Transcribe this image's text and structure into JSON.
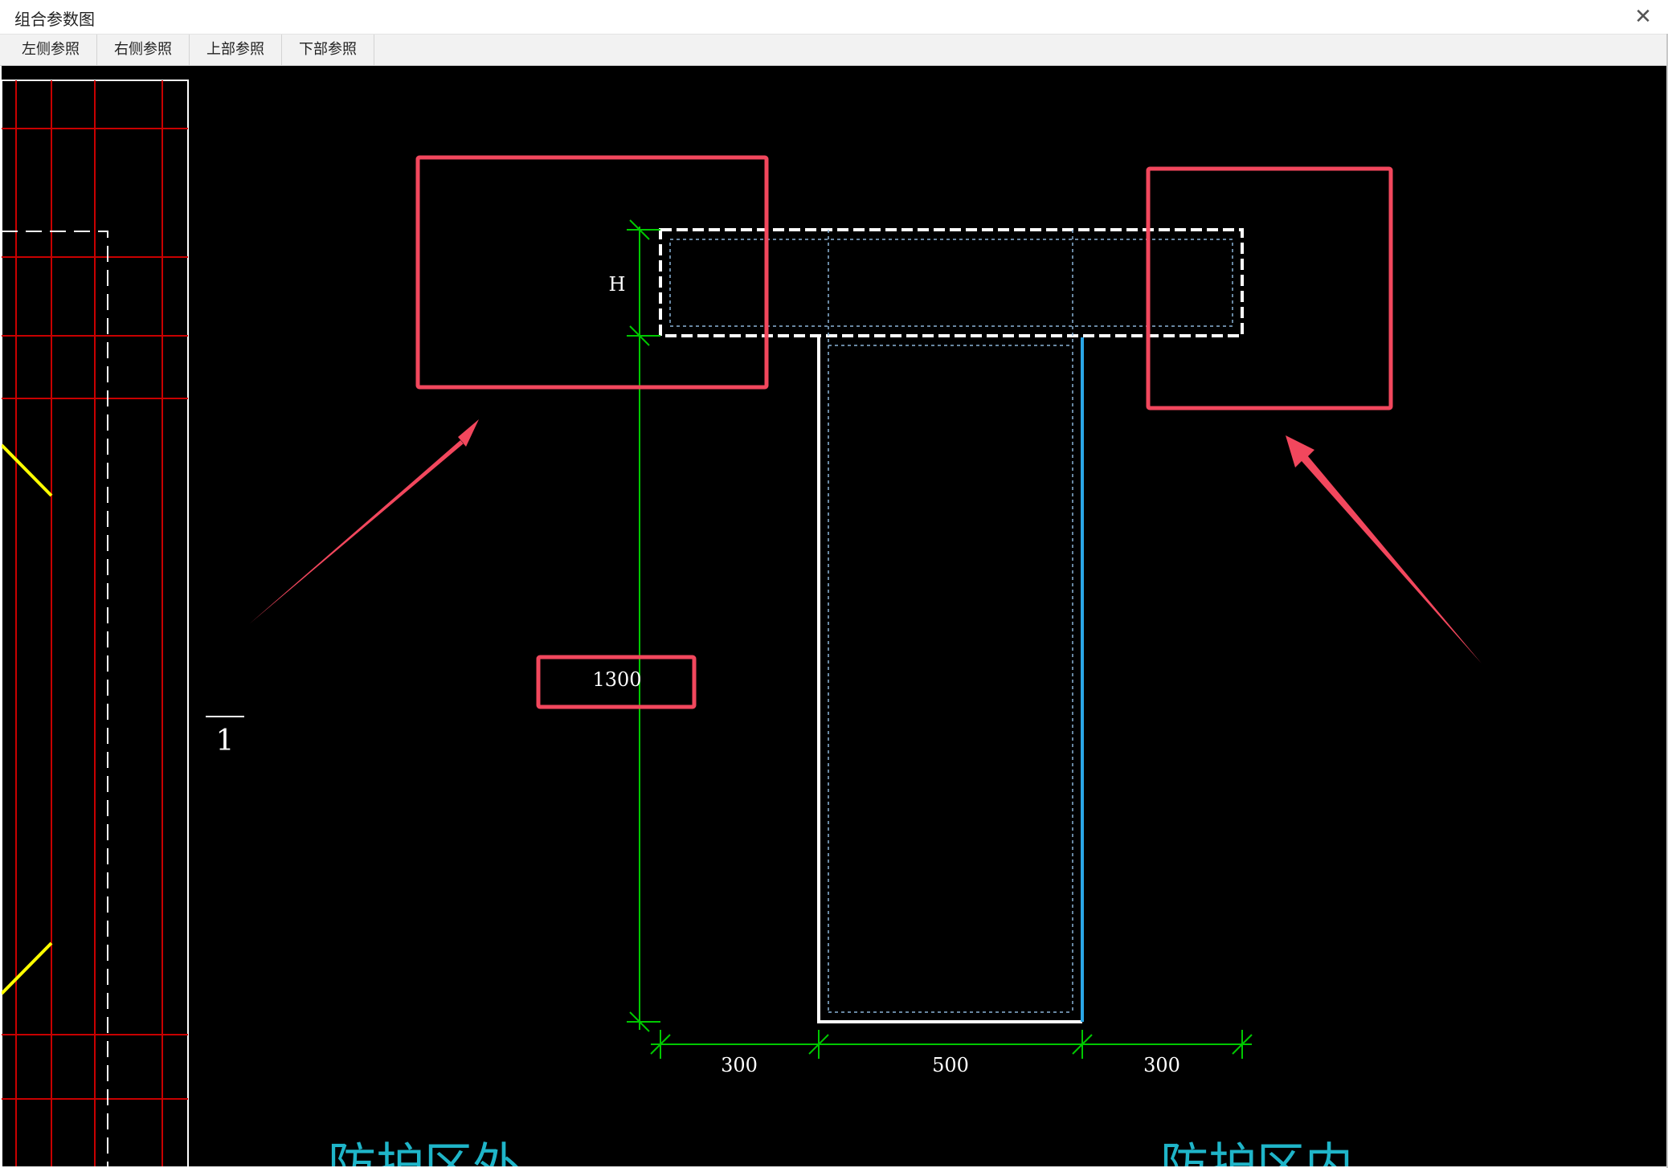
{
  "window": {
    "title": "组合参数图"
  },
  "toolbar": {
    "buttons": [
      {
        "label": "左侧参照"
      },
      {
        "label": "右侧参照"
      },
      {
        "label": "上部参照"
      },
      {
        "label": "下部参照"
      }
    ]
  },
  "drawing": {
    "height_symbol": "H",
    "height_value": "1300",
    "section_mark": "1",
    "dims_bottom": [
      "300",
      "500",
      "300"
    ],
    "zone_outside": "防护区外",
    "zone_inside": "防护区内",
    "colors": {
      "background": "#000000",
      "highlight": "#f2475d",
      "dimension": "#00c800",
      "grid": "#c80000",
      "cyan_text": "#1fb5c9",
      "blue_edge": "#2aa6e6",
      "yellow": "#ffff00"
    }
  }
}
